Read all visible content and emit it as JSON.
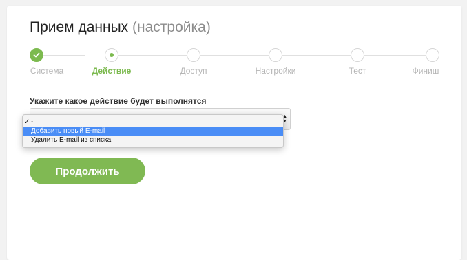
{
  "header": {
    "title": "Прием данных",
    "subtitle": "(настройка)"
  },
  "stepper": {
    "steps": [
      {
        "label": "Система",
        "state": "done"
      },
      {
        "label": "Действие",
        "state": "active"
      },
      {
        "label": "Доступ",
        "state": "pending"
      },
      {
        "label": "Настройки",
        "state": "pending"
      },
      {
        "label": "Тест",
        "state": "pending"
      },
      {
        "label": "Финиш",
        "state": "pending"
      }
    ]
  },
  "form": {
    "label": "Укажите какое действие будет выполнятся",
    "select": {
      "options": [
        {
          "label": "-",
          "checked": true,
          "highlighted": false
        },
        {
          "label": "Добавить новый E-mail",
          "checked": false,
          "highlighted": true
        },
        {
          "label": "Удалить E-mail из списка",
          "checked": false,
          "highlighted": false
        }
      ],
      "check_glyph": "✓"
    }
  },
  "actions": {
    "continue_label": "Продолжить"
  },
  "colors": {
    "accent": "#7cba4f",
    "button": "#80b953",
    "highlight": "#4a8df6",
    "muted_text": "#b5b5b5"
  },
  "icons": {
    "done_step": "checkmark-icon",
    "active_step": "dot-icon",
    "select_arrows": "chevron-updown-icon"
  }
}
